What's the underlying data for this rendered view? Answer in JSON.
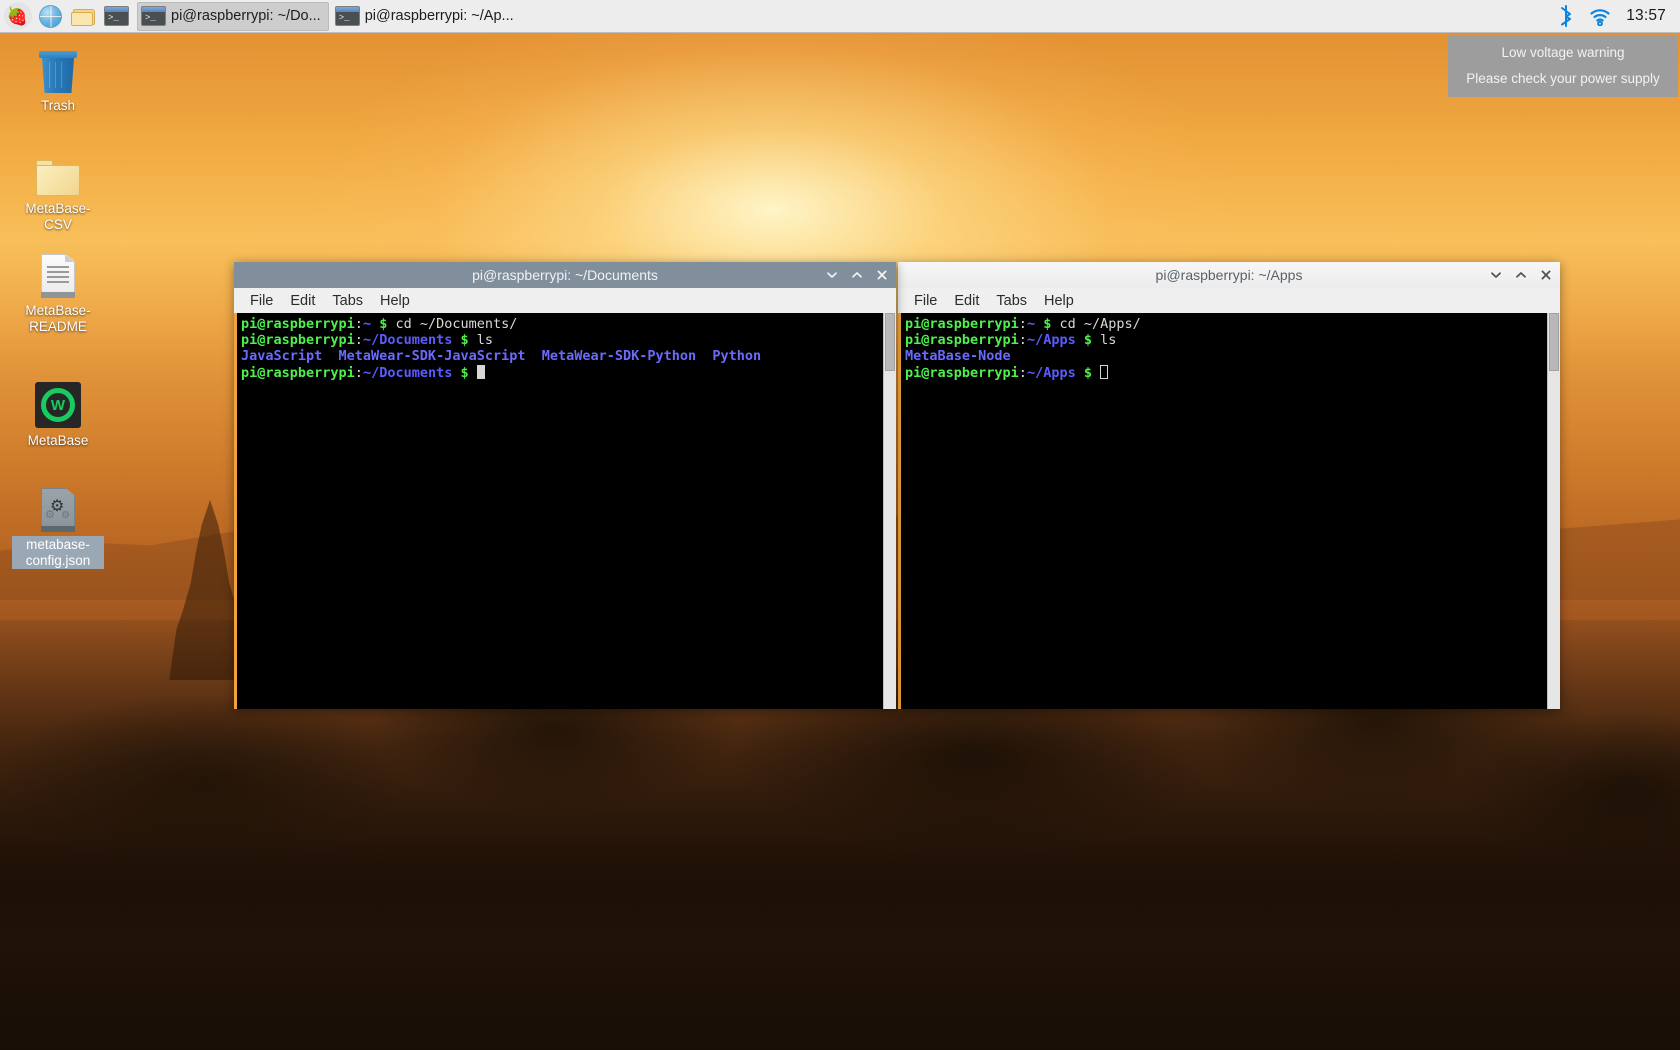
{
  "taskbar": {
    "launchers": [
      {
        "name": "raspberry-menu-icon",
        "glyph": "raspberry"
      },
      {
        "name": "web-browser-icon",
        "glyph": "globe"
      },
      {
        "name": "file-manager-icon",
        "glyph": "folder"
      },
      {
        "name": "terminal-launcher-icon",
        "glyph": "terminal"
      }
    ],
    "tasks": [
      {
        "label": "pi@raspberrypi: ~/Do...",
        "active": true
      },
      {
        "label": "pi@raspberrypi: ~/Ap...",
        "active": false
      }
    ],
    "tray": {
      "bluetooth_icon": "bluetooth-icon",
      "wifi_icon": "wifi-icon",
      "clock": "13:57"
    },
    "accent_color": "#0a84e0",
    "background_color": "#ededed"
  },
  "notification": {
    "title": "Low voltage warning",
    "message": "Please check your power supply",
    "background_color": "#9d9d9d",
    "text_color": "#f2f2f2"
  },
  "desktop_icons": [
    {
      "label": "Trash",
      "icon": "trash-icon",
      "selected": false
    },
    {
      "label": "MetaBase-CSV",
      "icon": "folder-icon",
      "selected": false
    },
    {
      "label": "MetaBase-README",
      "icon": "text-document-icon",
      "selected": false
    },
    {
      "label": "MetaBase",
      "icon": "metabase-app-icon",
      "selected": false
    },
    {
      "label": "metabase-config.json",
      "icon": "config-file-icon",
      "selected": true
    }
  ],
  "windows": [
    {
      "title": "pi@raspberrypi: ~/Documents",
      "active": true,
      "menu": [
        "File",
        "Edit",
        "Tabs",
        "Help"
      ],
      "buttons": {
        "minimize": "⌄",
        "maximize": "⌃",
        "close": "✕"
      },
      "lines": [
        {
          "parts": [
            {
              "text": "pi@raspberrypi",
              "color": "green"
            },
            {
              "text": ":",
              "color": "white"
            },
            {
              "text": "~",
              "color": "blue"
            },
            {
              "text": " ",
              "color": "white"
            },
            {
              "text": "$",
              "color": "green"
            },
            {
              "text": " cd ~/Documents/",
              "color": "white"
            }
          ]
        },
        {
          "parts": [
            {
              "text": "pi@raspberrypi",
              "color": "green"
            },
            {
              "text": ":",
              "color": "white"
            },
            {
              "text": "~/Documents",
              "color": "blue"
            },
            {
              "text": " ",
              "color": "white"
            },
            {
              "text": "$",
              "color": "green"
            },
            {
              "text": " ls",
              "color": "white"
            }
          ]
        },
        {
          "parts": [
            {
              "text": "JavaScript  MetaWear-SDK-JavaScript  MetaWear-SDK-Python  Python",
              "color": "dirs"
            }
          ]
        },
        {
          "parts": [
            {
              "text": "pi@raspberrypi",
              "color": "green"
            },
            {
              "text": ":",
              "color": "white"
            },
            {
              "text": "~/Documents",
              "color": "blue"
            },
            {
              "text": " ",
              "color": "white"
            },
            {
              "text": "$",
              "color": "green"
            },
            {
              "text": " ",
              "color": "white"
            },
            {
              "text": "",
              "cursor": "filled"
            }
          ]
        }
      ]
    },
    {
      "title": "pi@raspberrypi: ~/Apps",
      "active": false,
      "menu": [
        "File",
        "Edit",
        "Tabs",
        "Help"
      ],
      "buttons": {
        "minimize": "⌄",
        "maximize": "⌃",
        "close": "✕"
      },
      "lines": [
        {
          "parts": [
            {
              "text": "pi@raspberrypi",
              "color": "green"
            },
            {
              "text": ":",
              "color": "white"
            },
            {
              "text": "~",
              "color": "blue"
            },
            {
              "text": " ",
              "color": "white"
            },
            {
              "text": "$",
              "color": "green"
            },
            {
              "text": " cd ~/Apps/",
              "color": "white"
            }
          ]
        },
        {
          "parts": [
            {
              "text": "pi@raspberrypi",
              "color": "green"
            },
            {
              "text": ":",
              "color": "white"
            },
            {
              "text": "~/Apps",
              "color": "blue"
            },
            {
              "text": " ",
              "color": "white"
            },
            {
              "text": "$",
              "color": "green"
            },
            {
              "text": " ls",
              "color": "white"
            }
          ]
        },
        {
          "parts": [
            {
              "text": "MetaBase-Node",
              "color": "dirs"
            }
          ]
        },
        {
          "parts": [
            {
              "text": "pi@raspberrypi",
              "color": "green"
            },
            {
              "text": ":",
              "color": "white"
            },
            {
              "text": "~/Apps",
              "color": "blue"
            },
            {
              "text": " ",
              "color": "white"
            },
            {
              "text": "$",
              "color": "green"
            },
            {
              "text": " ",
              "color": "white"
            },
            {
              "text": "",
              "cursor": "hollow"
            }
          ]
        }
      ]
    }
  ],
  "theme": {
    "terminal_background": "#000000",
    "terminal_prompt_green": "#4ef04e",
    "terminal_path_blue": "#5b5bff",
    "terminal_dir_blue": "#6a6aff",
    "active_titlebar": "#818e9b",
    "window_accent_stripe": "#f0a33c"
  }
}
